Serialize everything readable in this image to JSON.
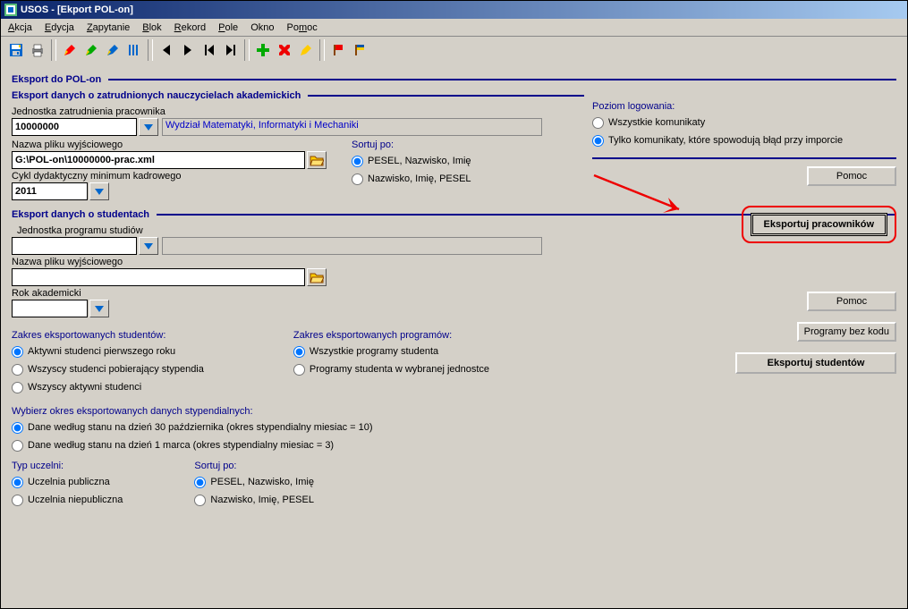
{
  "window_title": "USOS - [Ekport POL-on]",
  "menubar": {
    "akcja": "Akcja",
    "edycja": "Edycja",
    "zapytanie": "Zapytanie",
    "blok": "Blok",
    "rekord": "Rekord",
    "pole": "Pole",
    "okno": "Okno",
    "pomoc": "Pomoc"
  },
  "section": {
    "main": "Eksport do POL-on",
    "teachers": "Eksport danych o zatrudnionych nauczycielach akademickich",
    "students": "Eksport danych o studentach"
  },
  "teachers": {
    "unit_label": "Jednostka zatrudnienia pracownika",
    "unit_value": "10000000",
    "unit_name": "Wydział Matematyki, Informatyki i Mechaniki",
    "file_label": "Nazwa pliku wyjściowego",
    "file_value": "G:\\POL-on\\10000000-prac.xml",
    "cycle_label": "Cykl dydaktyczny minimum kadrowego",
    "cycle_value": "2011",
    "sort_label": "Sortuj po:",
    "sort_1": "PESEL, Nazwisko, Imię",
    "sort_2": "Nazwisko, Imię, PESEL"
  },
  "loglevel": {
    "title": "Poziom logowania:",
    "opt1": "Wszystkie komunikaty",
    "opt2": "Tylko komunikaty, które spowodują błąd przy imporcie"
  },
  "buttons": {
    "pomoc": "Pomoc",
    "export_teachers": "Eksportuj pracowników",
    "programy": "Programy bez kodu",
    "export_students": "Eksportuj studentów"
  },
  "students": {
    "unit_label": "Jednostka programu studiów",
    "file_label": "Nazwa pliku wyjściowego",
    "year_label": "Rok akademicki",
    "scope_s_title": "Zakres eksportowanych studentów:",
    "scope_s_1": "Aktywni studenci pierwszego roku",
    "scope_s_2": "Wszyscy studenci pobierający stypendia",
    "scope_s_3": "Wszyscy aktywni studenci",
    "scope_p_title": "Zakres eksportowanych programów:",
    "scope_p_1": "Wszystkie programy studenta",
    "scope_p_2": "Programy studenta w wybranej jednostce",
    "styp_title": "Wybierz okres eksportowanych danych stypendialnych:",
    "styp_1": "Dane według stanu na dzień 30 października (okres stypendialny miesiac = 10)",
    "styp_2": "Dane według stanu na dzień 1 marca (okres stypendialny miesiac = 3)",
    "type_title": "Typ uczelni:",
    "type_1": "Uczelnia publiczna",
    "type_2": "Uczelnia niepubliczna",
    "sort_title": "Sortuj po:",
    "sort_1": "PESEL, Nazwisko, Imię",
    "sort_2": "Nazwisko, Imię, PESEL"
  }
}
